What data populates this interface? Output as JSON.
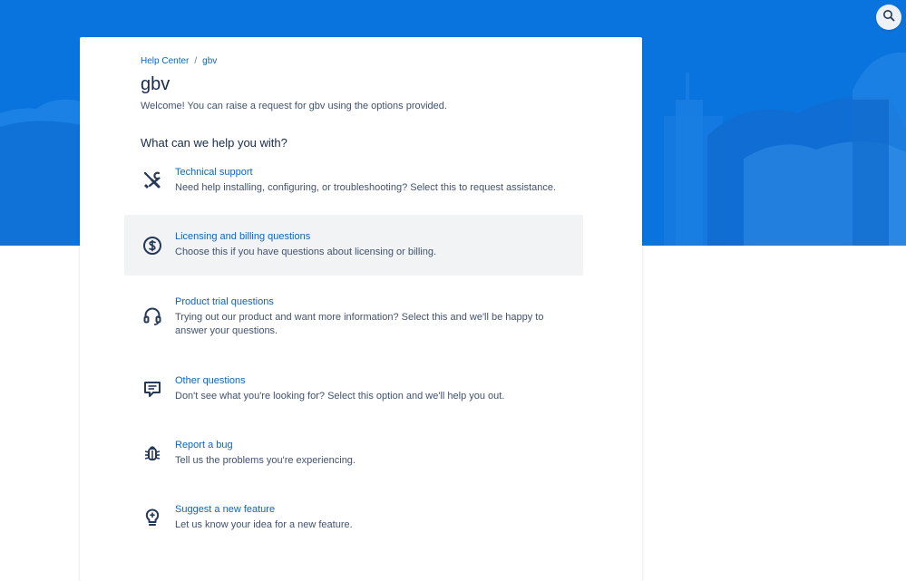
{
  "header": {
    "search_icon": "search-icon",
    "banner_color": "#0a74de"
  },
  "breadcrumb": {
    "root": "Help Center",
    "separator": "/",
    "current": "gbv"
  },
  "page": {
    "title": "gbv",
    "welcome": "Welcome! You can raise a request for gbv using the options provided.",
    "section_heading": "What can we help you with?"
  },
  "options": [
    {
      "icon": "wrench-screwdriver-icon",
      "title": "Technical support",
      "description": "Need help installing, configuring, or troubleshooting? Select this to request assistance."
    },
    {
      "icon": "dollar-circle-icon",
      "title": "Licensing and billing questions",
      "description": "Choose this if you have questions about licensing or billing."
    },
    {
      "icon": "headset-icon",
      "title": "Product trial questions",
      "description": "Trying out our product and want more information? Select this and we'll be happy to answer your questions."
    },
    {
      "icon": "chat-bubble-icon",
      "title": "Other questions",
      "description": "Don't see what you're looking for? Select this option and we'll help you out."
    },
    {
      "icon": "bug-icon",
      "title": "Report a bug",
      "description": "Tell us the problems you're experiencing."
    },
    {
      "icon": "lightbulb-icon",
      "title": "Suggest a new feature",
      "description": "Let us know your idea for a new feature."
    }
  ],
  "colors": {
    "link": "#0a66c2",
    "text_primary": "#172b4d",
    "text_secondary": "#42526e",
    "hover_bg": "#f2f3f5"
  }
}
